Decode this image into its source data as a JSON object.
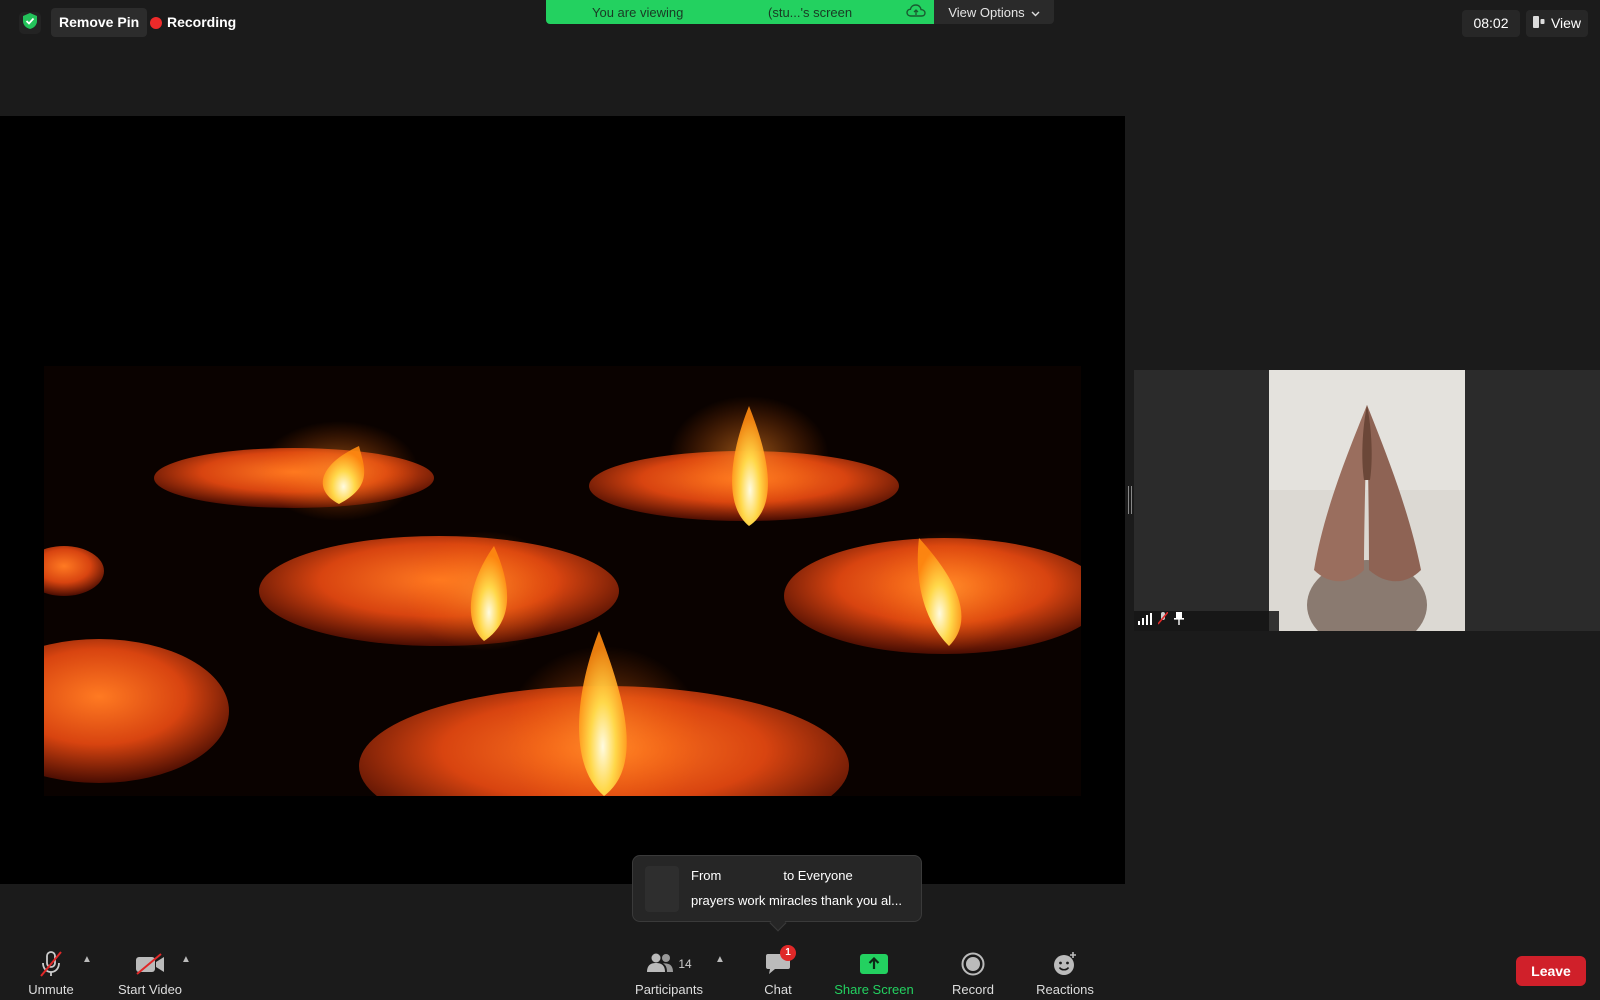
{
  "top_bar": {
    "remove_pin_label": "Remove Pin",
    "recording_label": "Recording",
    "viewing_banner": {
      "prefix": "You are viewing",
      "suffix": "(stu...'s screen"
    },
    "view_options_label": "View Options",
    "clock": "08:02",
    "view_label": "View"
  },
  "chat_toast": {
    "from_label": "From",
    "to_label": "to Everyone",
    "message": "prayers work miracles thank you al..."
  },
  "toolbar": {
    "unmute_label": "Unmute",
    "start_video_label": "Start Video",
    "participants_label": "Participants",
    "participants_count": "14",
    "chat_label": "Chat",
    "chat_badge": "1",
    "share_screen_label": "Share Screen",
    "record_label": "Record",
    "reactions_label": "Reactions",
    "leave_label": "Leave"
  },
  "colors": {
    "banner_green": "#23d160",
    "share_green": "#23d160",
    "leave_red": "#d0202a",
    "recording_red": "#ee2a2a"
  },
  "icons": [
    "shield-icon",
    "recording-dot-icon",
    "cloud-icon",
    "chevron-down-icon",
    "view-layout-icon",
    "microphone-muted-icon",
    "video-camera-off-icon",
    "participants-icon",
    "chat-bubble-icon",
    "share-screen-icon",
    "record-icon",
    "reactions-icon",
    "signal-icon",
    "mic-muted-small-icon",
    "pin-icon"
  ]
}
